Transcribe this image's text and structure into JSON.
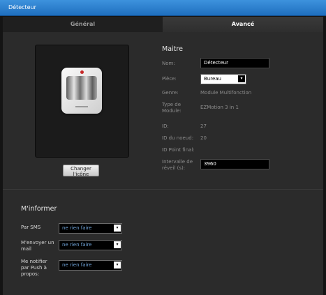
{
  "window": {
    "title": "Détecteur"
  },
  "tabs": {
    "general": "Général",
    "advanced": "Avancé"
  },
  "device_image": {
    "change_icon_label": "Changer l'icône"
  },
  "maitre": {
    "title": "Maitre",
    "fields": {
      "name_label": "Nom:",
      "name_value": "Détecteur",
      "room_label": "Pièce:",
      "room_value": "Bureau",
      "genre_label": "Genre:",
      "genre_value": "Module Multifonction",
      "type_label": "Type de Module:",
      "type_value": "EZMotion 3 in 1",
      "id_label": "ID:",
      "id_value": "27",
      "node_id_label": "ID du noeud:",
      "node_id_value": "20",
      "final_id_label": "ID Point final:",
      "final_id_value": "",
      "wake_label": "Intervalle de réveil (s):",
      "wake_value": "3960"
    }
  },
  "notify": {
    "title": "M'informer",
    "sms_label": "Par SMS",
    "sms_value": "ne rien faire",
    "mail_label": "M'envoyer un mail",
    "mail_value": "ne rien faire",
    "push_label": "Me notifier par Push à propos:",
    "push_value": "ne rien faire"
  },
  "icons": {
    "dropdown": "▾"
  },
  "colors": {
    "titlebar": "#2a7fd0",
    "panel": "#2b2b2b",
    "accent_text": "#6fa3d8"
  }
}
